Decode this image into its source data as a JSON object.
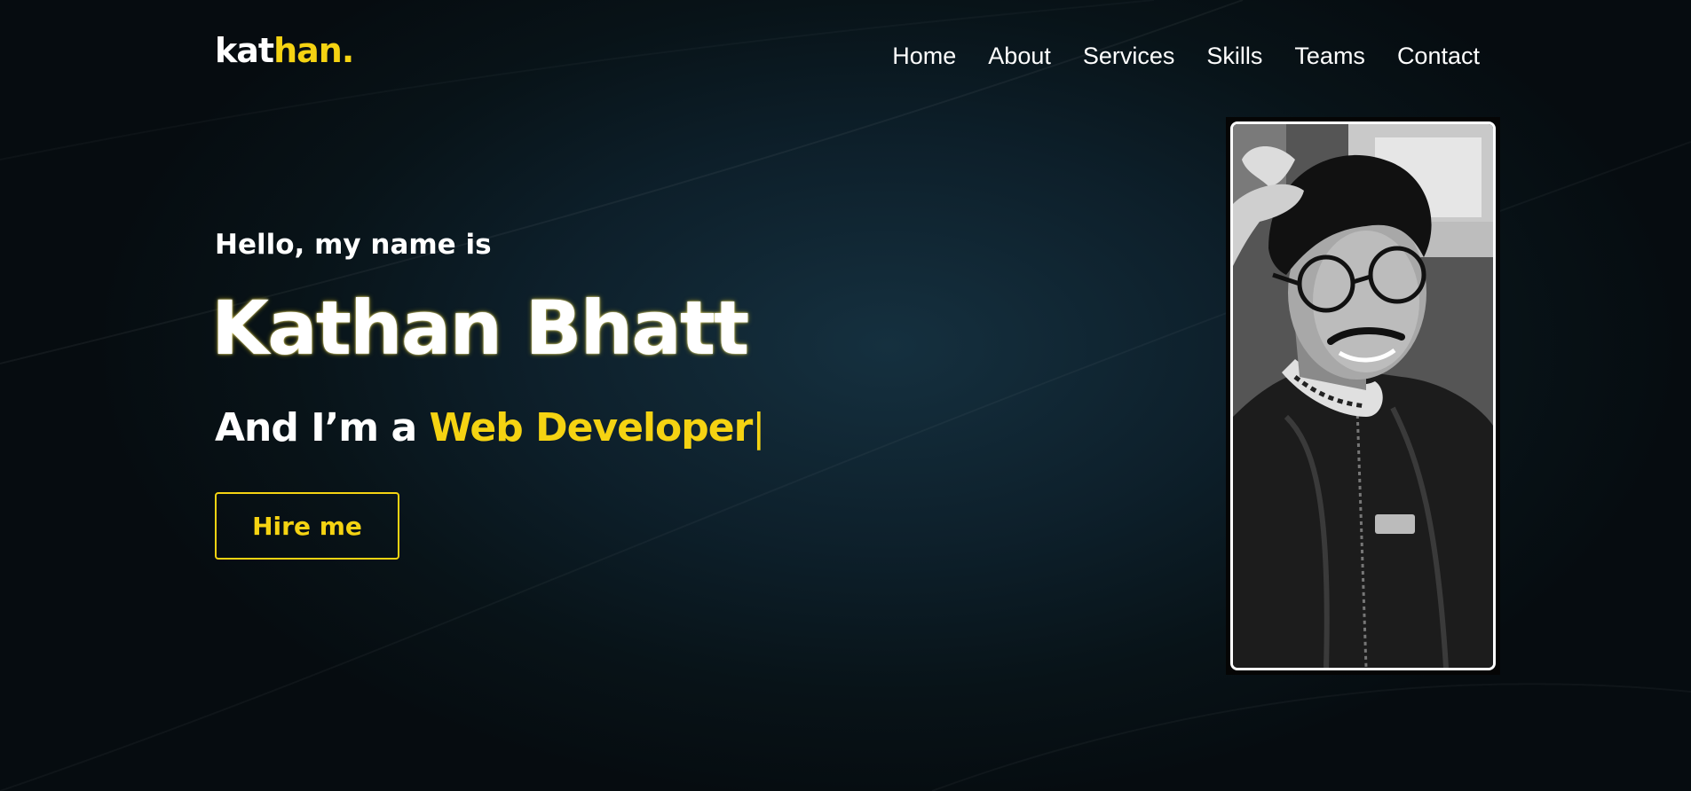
{
  "colors": {
    "accent": "#f5d312",
    "background": "#0a1820",
    "text": "#ffffff"
  },
  "nav": {
    "logo_part1": "kat",
    "logo_part2": "han.",
    "links": [
      "Home",
      "About",
      "Services",
      "Skills",
      "Teams",
      "Contact"
    ]
  },
  "hero": {
    "greeting": "Hello, my name is",
    "name": "Kathan Bhatt",
    "role_prefix": "And I’m a ",
    "role": "Web Developer",
    "cursor": "|",
    "button": "Hire me"
  },
  "photo": {
    "subject": "black-and-white portrait photo",
    "icon": "portrait-photo"
  }
}
